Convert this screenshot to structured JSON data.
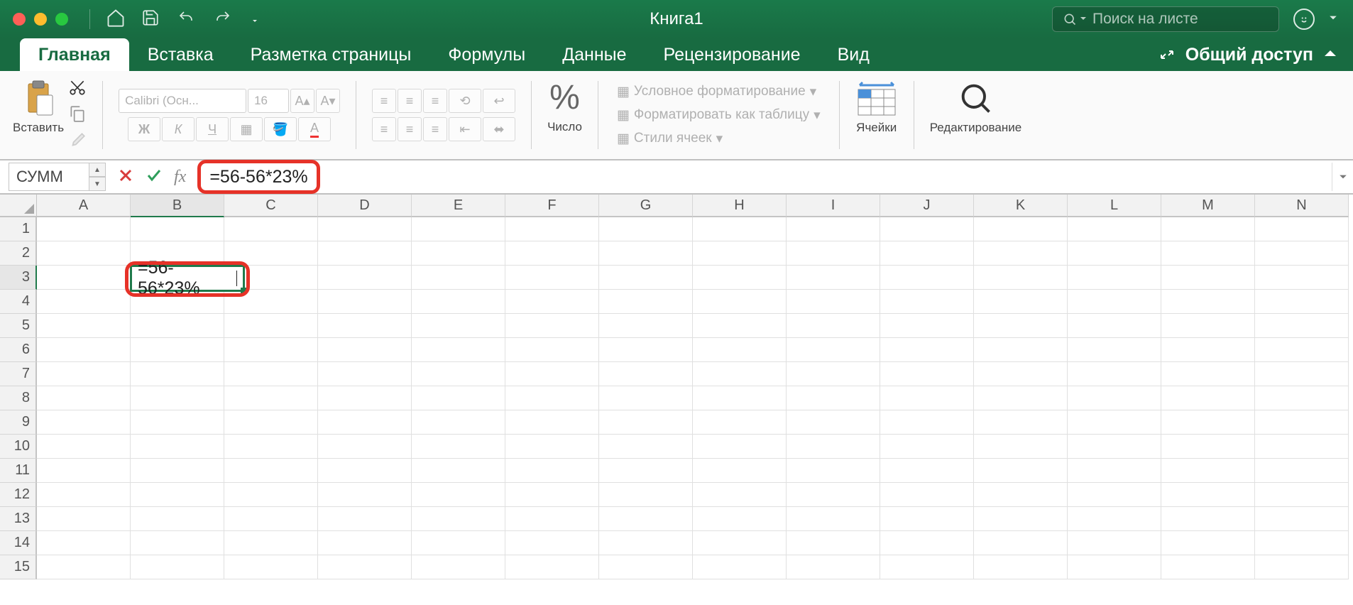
{
  "window_title": "Книга1",
  "search_placeholder": "Поиск на листе",
  "share_label": "Общий доступ",
  "tabs": [
    "Главная",
    "Вставка",
    "Разметка страницы",
    "Формулы",
    "Данные",
    "Рецензирование",
    "Вид"
  ],
  "active_tab_index": 0,
  "ribbon": {
    "paste_label": "Вставить",
    "font_name": "Calibri (Осн...",
    "font_size": "16",
    "number_label": "Число",
    "cond_fmt": "Условное форматирование",
    "table_fmt": "Форматировать как таблицу",
    "cell_styles": "Стили ячеек",
    "cells_label": "Ячейки",
    "editing_label": "Редактирование"
  },
  "name_box_value": "СУММ",
  "formula_value": "=56-56*23%",
  "columns": [
    "A",
    "B",
    "C",
    "D",
    "E",
    "F",
    "G",
    "H",
    "I",
    "J",
    "K",
    "L",
    "M",
    "N"
  ],
  "row_count": 15,
  "active_cell": {
    "col": "B",
    "row": 3,
    "value": "=56-56*23%"
  }
}
